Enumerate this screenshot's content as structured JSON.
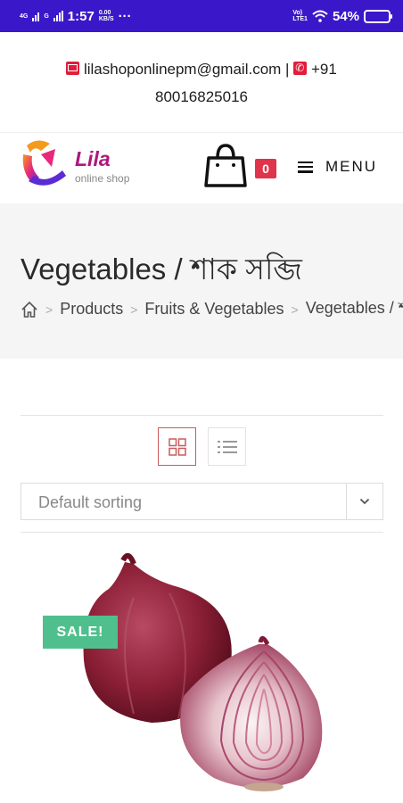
{
  "status_bar": {
    "net1": "4G",
    "net2": "G",
    "time": "1:57",
    "speed_value": "0.00",
    "speed_unit": "KB/S",
    "dots": "···",
    "volte1": "Vo)",
    "volte2": "LTE1",
    "battery_text": "54%",
    "battery_level": 0.54
  },
  "contact": {
    "email": "lilashoponlinepm@gmail.com",
    "separator": "|",
    "phone": "+91 80016825016"
  },
  "header": {
    "logo_text": "Lila",
    "logo_sub": "online shop",
    "cart_count": "0",
    "menu_label": "MENU"
  },
  "hero": {
    "title": "Vegetables / শাক সব্জি",
    "breadcrumb": [
      "Products",
      "Fruits & Vegetables",
      "Vegetables / শাক সব্জি"
    ],
    "breadcrumb_sep": ">"
  },
  "toolbar": {
    "sort_selected": "Default sorting"
  },
  "product": {
    "badge": "SALE!"
  },
  "colors": {
    "status_bar": "#3a18c9",
    "accent_red": "#e0344a",
    "sale_green": "#4fc08d",
    "hero_bg": "#f5f5f5"
  },
  "icons": [
    "envelope-icon",
    "phone-icon",
    "shopping-bag-icon",
    "hamburger-icon",
    "home-icon",
    "grid-view-icon",
    "list-view-icon",
    "chevron-down-icon"
  ]
}
